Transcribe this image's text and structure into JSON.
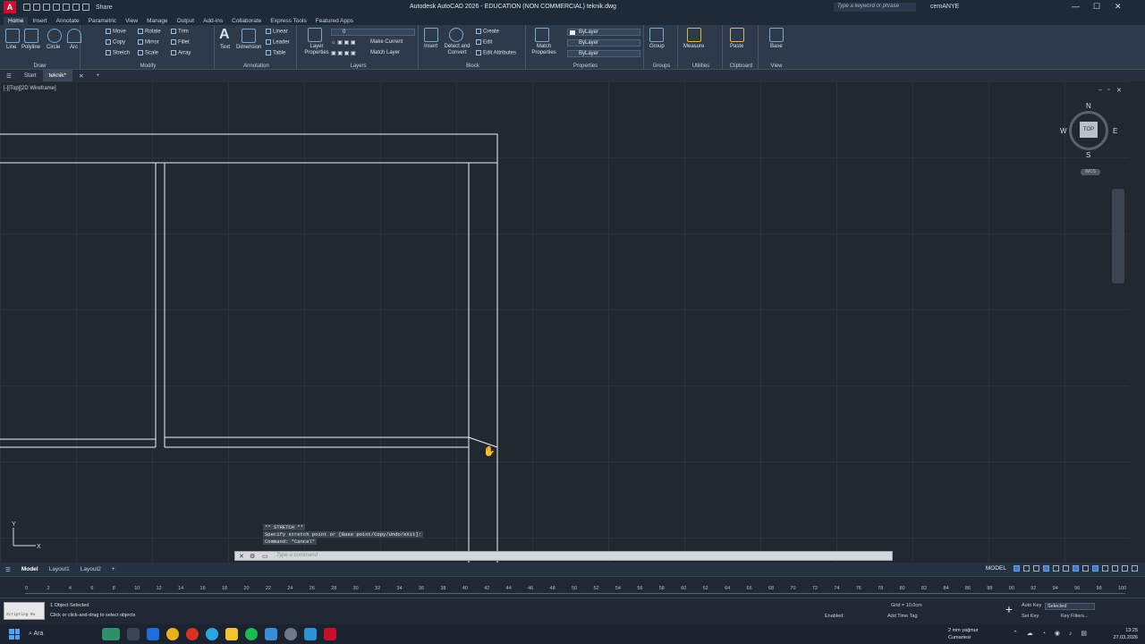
{
  "window": {
    "app_logo": "A",
    "title": "Autodesk AutoCAD 2026 - EDUCATION (NON COMMERCIAL)   teknik.dwg",
    "share_label": "Share",
    "search_placeholder": "Type a keyword or phrase",
    "user": "cemANYE",
    "minimize": "—",
    "maximize": "☐",
    "close": "✕"
  },
  "ribbon_tabs": [
    "Home",
    "Insert",
    "Annotate",
    "Parametric",
    "View",
    "Manage",
    "Output",
    "Add-ins",
    "Collaborate",
    "Express Tools",
    "Featured Apps"
  ],
  "ribbon": {
    "draw": {
      "title": "Draw",
      "tools": [
        "Line",
        "Polyline",
        "Circle",
        "Arc"
      ]
    },
    "modify": {
      "title": "Modify",
      "tools": [
        "Move",
        "Rotate",
        "Trim",
        "Copy",
        "Mirror",
        "Fillet",
        "Stretch",
        "Scale",
        "Array"
      ]
    },
    "annotation": {
      "title": "Annotation",
      "tools": [
        "Text",
        "Dimension"
      ],
      "small": [
        "Linear",
        "Leader",
        "Table"
      ]
    },
    "layers": {
      "title": "Layers",
      "layer_properties": "Layer Properties",
      "current_layer": "0",
      "make_current": "Make Current",
      "match_layer": "Match Layer"
    },
    "block": {
      "title": "Block",
      "insert": "Insert",
      "detect": "Detect and Convert",
      "create": "Create",
      "edit": "Edit",
      "edit_attributes": "Edit Attributes"
    },
    "properties": {
      "title": "Properties",
      "match": "Match Properties",
      "color": "ByLayer",
      "linetype": "ByLayer",
      "lineweight": "ByLayer"
    },
    "groups": {
      "title": "Groups",
      "group": "Group"
    },
    "utilities": {
      "title": "Utilities",
      "measure": "Measure"
    },
    "clipboard": {
      "title": "Clipboard",
      "paste": "Paste"
    },
    "view": {
      "title": "View",
      "base": "Base"
    }
  },
  "file_tabs": {
    "start": "Start",
    "active": "teknik*"
  },
  "viewport": {
    "label": "[-][Top][2D Wireframe]",
    "viewcube": {
      "top": "TOP",
      "n": "N",
      "s": "S",
      "e": "E",
      "w": "W",
      "wcs": "WCS"
    }
  },
  "command": {
    "history": [
      "** STRETCH **",
      "Specify stretch point or [Base point/Copy/Undo/eXit]:",
      "Command: *Cancel*"
    ],
    "placeholder": "Type a command"
  },
  "layout_tabs": [
    "Model",
    "Layout1",
    "Layout2"
  ],
  "status": {
    "model": "MODEL"
  },
  "timeline": {
    "ticks": [
      "0",
      "2",
      "4",
      "6",
      "8",
      "10",
      "12",
      "14",
      "16",
      "18",
      "20",
      "22",
      "24",
      "26",
      "28",
      "30",
      "32",
      "34",
      "36",
      "38",
      "40",
      "42",
      "44",
      "46",
      "48",
      "50",
      "52",
      "54",
      "56",
      "58",
      "60",
      "62",
      "64",
      "66",
      "68",
      "70",
      "72",
      "74",
      "76",
      "78",
      "80",
      "82",
      "84",
      "86",
      "88",
      "90",
      "92",
      "94",
      "96",
      "98",
      "100"
    ]
  },
  "anim": {
    "thumb_label": "Scripting Ru",
    "selected": "1 Object Selected",
    "hint": "Click or click-and-drag to select objects",
    "enabled": "Enabled:",
    "add_time_tag": "Add Time Tag",
    "grid": "Grid = 10,0cm",
    "auto_key": "Auto Key",
    "set_key": "Set Key",
    "selected_dd": "Selected",
    "key_filters": "Key Filters..."
  },
  "taskbar": {
    "search": "Ara",
    "weather_temp": "2 mm yağmur",
    "weather_day": "Cumartesi",
    "time": "13:25",
    "date": "27.03.2026"
  }
}
